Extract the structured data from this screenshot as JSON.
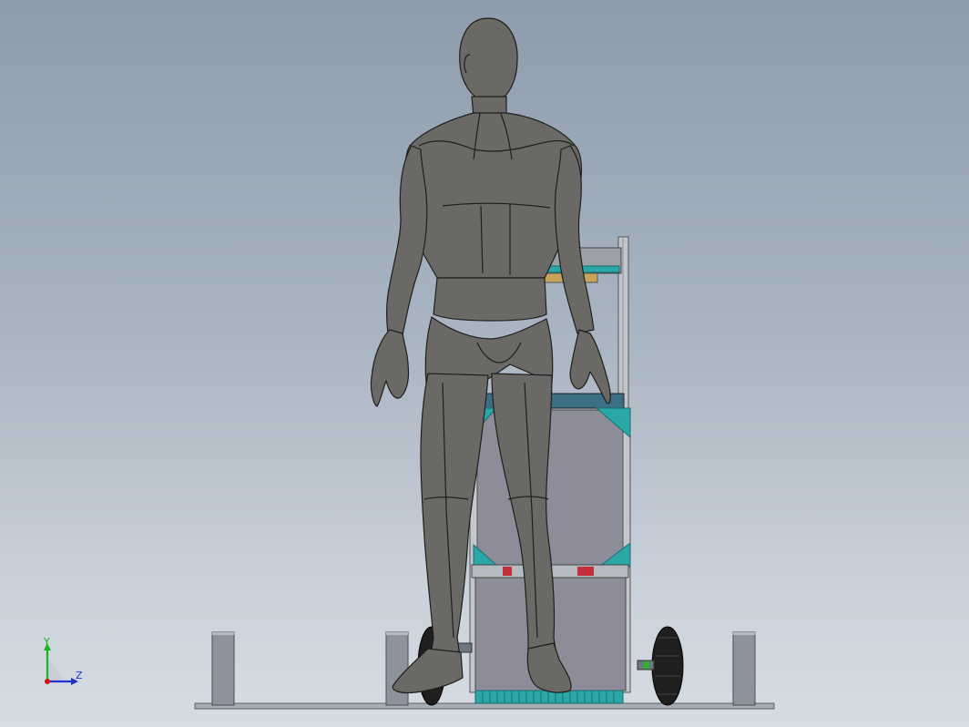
{
  "viewport": {
    "background_top": "#8e9cad",
    "background_bottom": "#d6dce3"
  },
  "model": {
    "figure_color": "#6b6965",
    "frame_color": "#b9bec4",
    "bracket_color": "#2aa7a7",
    "panel_color": "#8a8b96",
    "wheel_color": "#1f1f1f",
    "floor_color": "#9aa0a7"
  },
  "triad": {
    "y_label": "Y",
    "z_label": "Z",
    "y_color": "#1db31d",
    "z_color": "#2233cc",
    "x_color": "#d01010"
  }
}
